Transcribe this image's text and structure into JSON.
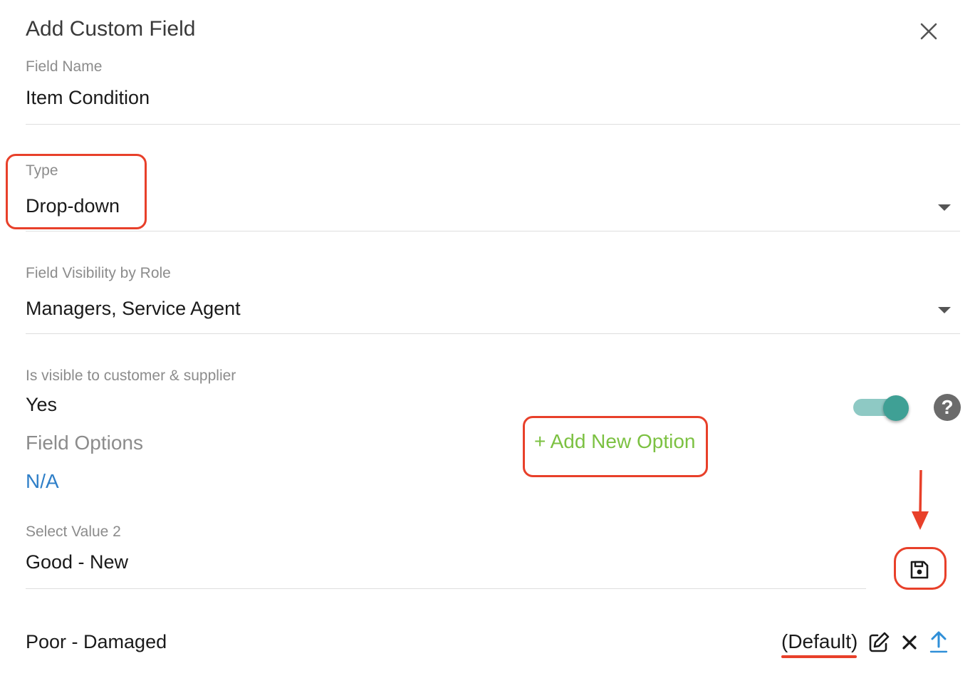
{
  "dialog": {
    "title": "Add Custom Field",
    "close_icon": "close-icon"
  },
  "field_name": {
    "label": "Field Name",
    "value": "Item Condition"
  },
  "type": {
    "label": "Type",
    "value": "Drop-down"
  },
  "visibility": {
    "label": "Field Visibility by Role",
    "value": "Managers, Service Agent"
  },
  "customer_supplier": {
    "label": "Is visible to customer & supplier",
    "value": "Yes",
    "toggle_on": true,
    "help_glyph": "?"
  },
  "field_options": {
    "label": "Field Options",
    "add_label": "+ Add New Option",
    "na_label": "N/A"
  },
  "select_value": {
    "label": "Select Value 2",
    "value": "Good - New"
  },
  "options": [
    {
      "label": "Poor - Damaged",
      "default_tag": "(Default)"
    }
  ],
  "colors": {
    "accent_green": "#7cc142",
    "toggle_teal": "#3fa095",
    "link_blue": "#2f7fc8",
    "annotation_red": "#e8402a"
  }
}
